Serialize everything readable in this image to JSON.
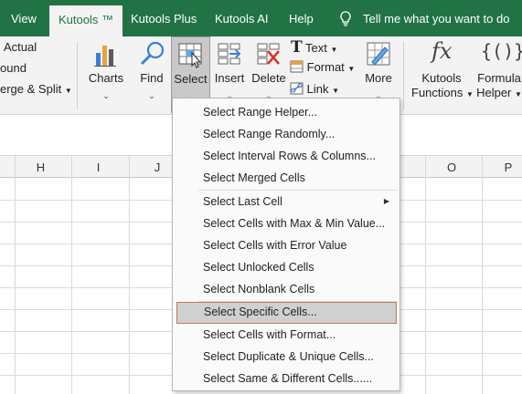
{
  "menubar": {
    "tabs": [
      "View",
      "Kutools ™",
      "Kutools Plus",
      "Kutools AI",
      "Help"
    ],
    "active_tab": "Kutools ™",
    "tell_me": "Tell me what you want to do"
  },
  "ribbon": {
    "left_items": [
      "Actual",
      "ound",
      "erge & Split"
    ],
    "buttons": {
      "charts": "Charts",
      "find": "Find",
      "select": "Select",
      "insert": "Insert",
      "delete": "Delete",
      "text": "Text",
      "format": "Format",
      "link": "Link",
      "more": "More",
      "kutools_functions_1": "Kutools",
      "kutools_functions_2": "Functions",
      "formula_helper_1": "Formula",
      "formula_helper_2": "Helper"
    }
  },
  "grid": {
    "columns": [
      "H",
      "I",
      "J",
      "O",
      "P"
    ]
  },
  "dropdown": {
    "items": [
      "Select Range Helper...",
      "Select Range Randomly...",
      "Select Interval Rows & Columns...",
      "Select Merged Cells",
      "Select Last Cell",
      "Select Cells with Max & Min Value...",
      "Select Cells with Error Value",
      "Select Unlocked Cells",
      "Select Nonblank Cells",
      "Select Specific Cells...",
      "Select Cells with Format...",
      "Select Duplicate & Unique Cells...",
      "Select Same & Different Cells......"
    ],
    "highlighted_item": "Select Specific Cells..."
  },
  "colors": {
    "excel_green": "#217346",
    "highlight_border": "#c7755c"
  },
  "icons": [
    "lightbulb-icon",
    "charts-icon",
    "find-magnifier-icon",
    "select-icon",
    "insert-icon",
    "delete-icon",
    "text-icon",
    "format-icon",
    "link-icon",
    "more-icon",
    "fx-icon",
    "formula-braces-icon",
    "submenu-arrow-icon",
    "chevron-down-icon"
  ]
}
